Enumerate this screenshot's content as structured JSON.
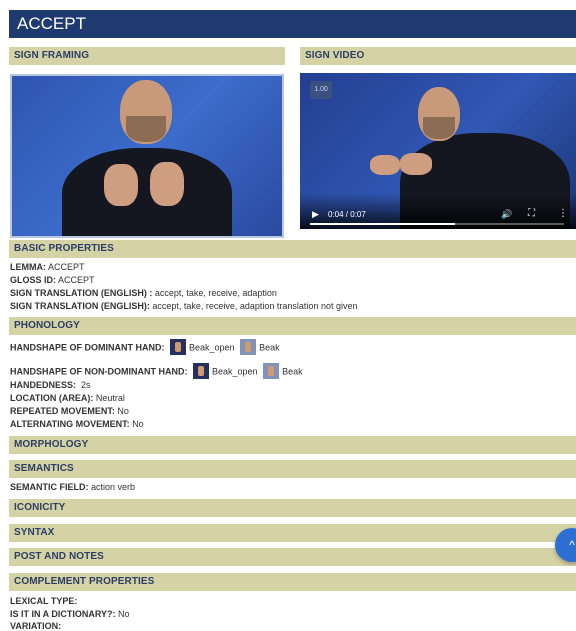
{
  "title": "ACCEPT",
  "sections": {
    "sign_framing": "SIGN FRAMING",
    "sign_video": "SIGN VIDEO",
    "basic_properties": "BASIC PROPERTIES",
    "phonology": "PHONOLOGY",
    "morphology": "MORPHOLOGY",
    "semantics": "SEMANTICS",
    "iconicity": "ICONICITY",
    "syntax": "SYNTAX",
    "post_and_notes": "POST AND NOTES",
    "complement_properties": "COMPLEMENT PROPERTIES"
  },
  "video": {
    "speed": "1.00",
    "time": "0:04 / 0:07",
    "progress_fraction": 0.57,
    "play_icon": "play-icon",
    "volume_icon": "volume-icon",
    "fullscreen_icon": "fullscreen-icon",
    "more_icon": "more-vertical-icon"
  },
  "basic": {
    "lemma_label": "LEMMA:",
    "lemma_value": "ACCEPT",
    "gloss_label": "GLOSS ID:",
    "gloss_value": "ACCEPT",
    "translation1_label": "SIGN TRANSLATION (ENGLISH) :",
    "translation1_value": "accept, take, receive, adaption",
    "translation2_label": "SIGN TRANSLATION (ENGLISH):",
    "translation2_value": "accept, take, receive, adaption translation not given"
  },
  "phonology": {
    "dominant_label": "HANDSHAPE OF DOMINANT HAND:",
    "dominant_shape1": "Beak_open",
    "dominant_shape2": "Beak",
    "nondominant_label": "HANDSHAPE OF NON-DOMINANT HAND:",
    "nondominant_shape1": "Beak_open",
    "nondominant_shape2": "Beak",
    "handedness_label": "HANDEDNESS:",
    "handedness_value": "2s",
    "location_label": "LOCATION (AREA):",
    "location_value": "Neutral",
    "repeated_label": "REPEATED MOVEMENT:",
    "repeated_value": "No",
    "alternating_label": "ALTERNATING MOVEMENT:",
    "alternating_value": "No"
  },
  "semantics": {
    "field_label": "SEMANTIC FIELD:",
    "field_value": "action verb"
  },
  "complement": {
    "lexical_label": "LEXICAL TYPE:",
    "lexical_value": "",
    "dictionary_label": "IS IT IN A DICTIONARY?:",
    "dictionary_value": "No",
    "variation_label": "VARIATION:"
  },
  "colors": {
    "title_bar": "#1e3a6e",
    "section_header": "#d5d2a6",
    "fab": "#2c6ed1"
  },
  "fab_icon": "chevron-up-icon"
}
